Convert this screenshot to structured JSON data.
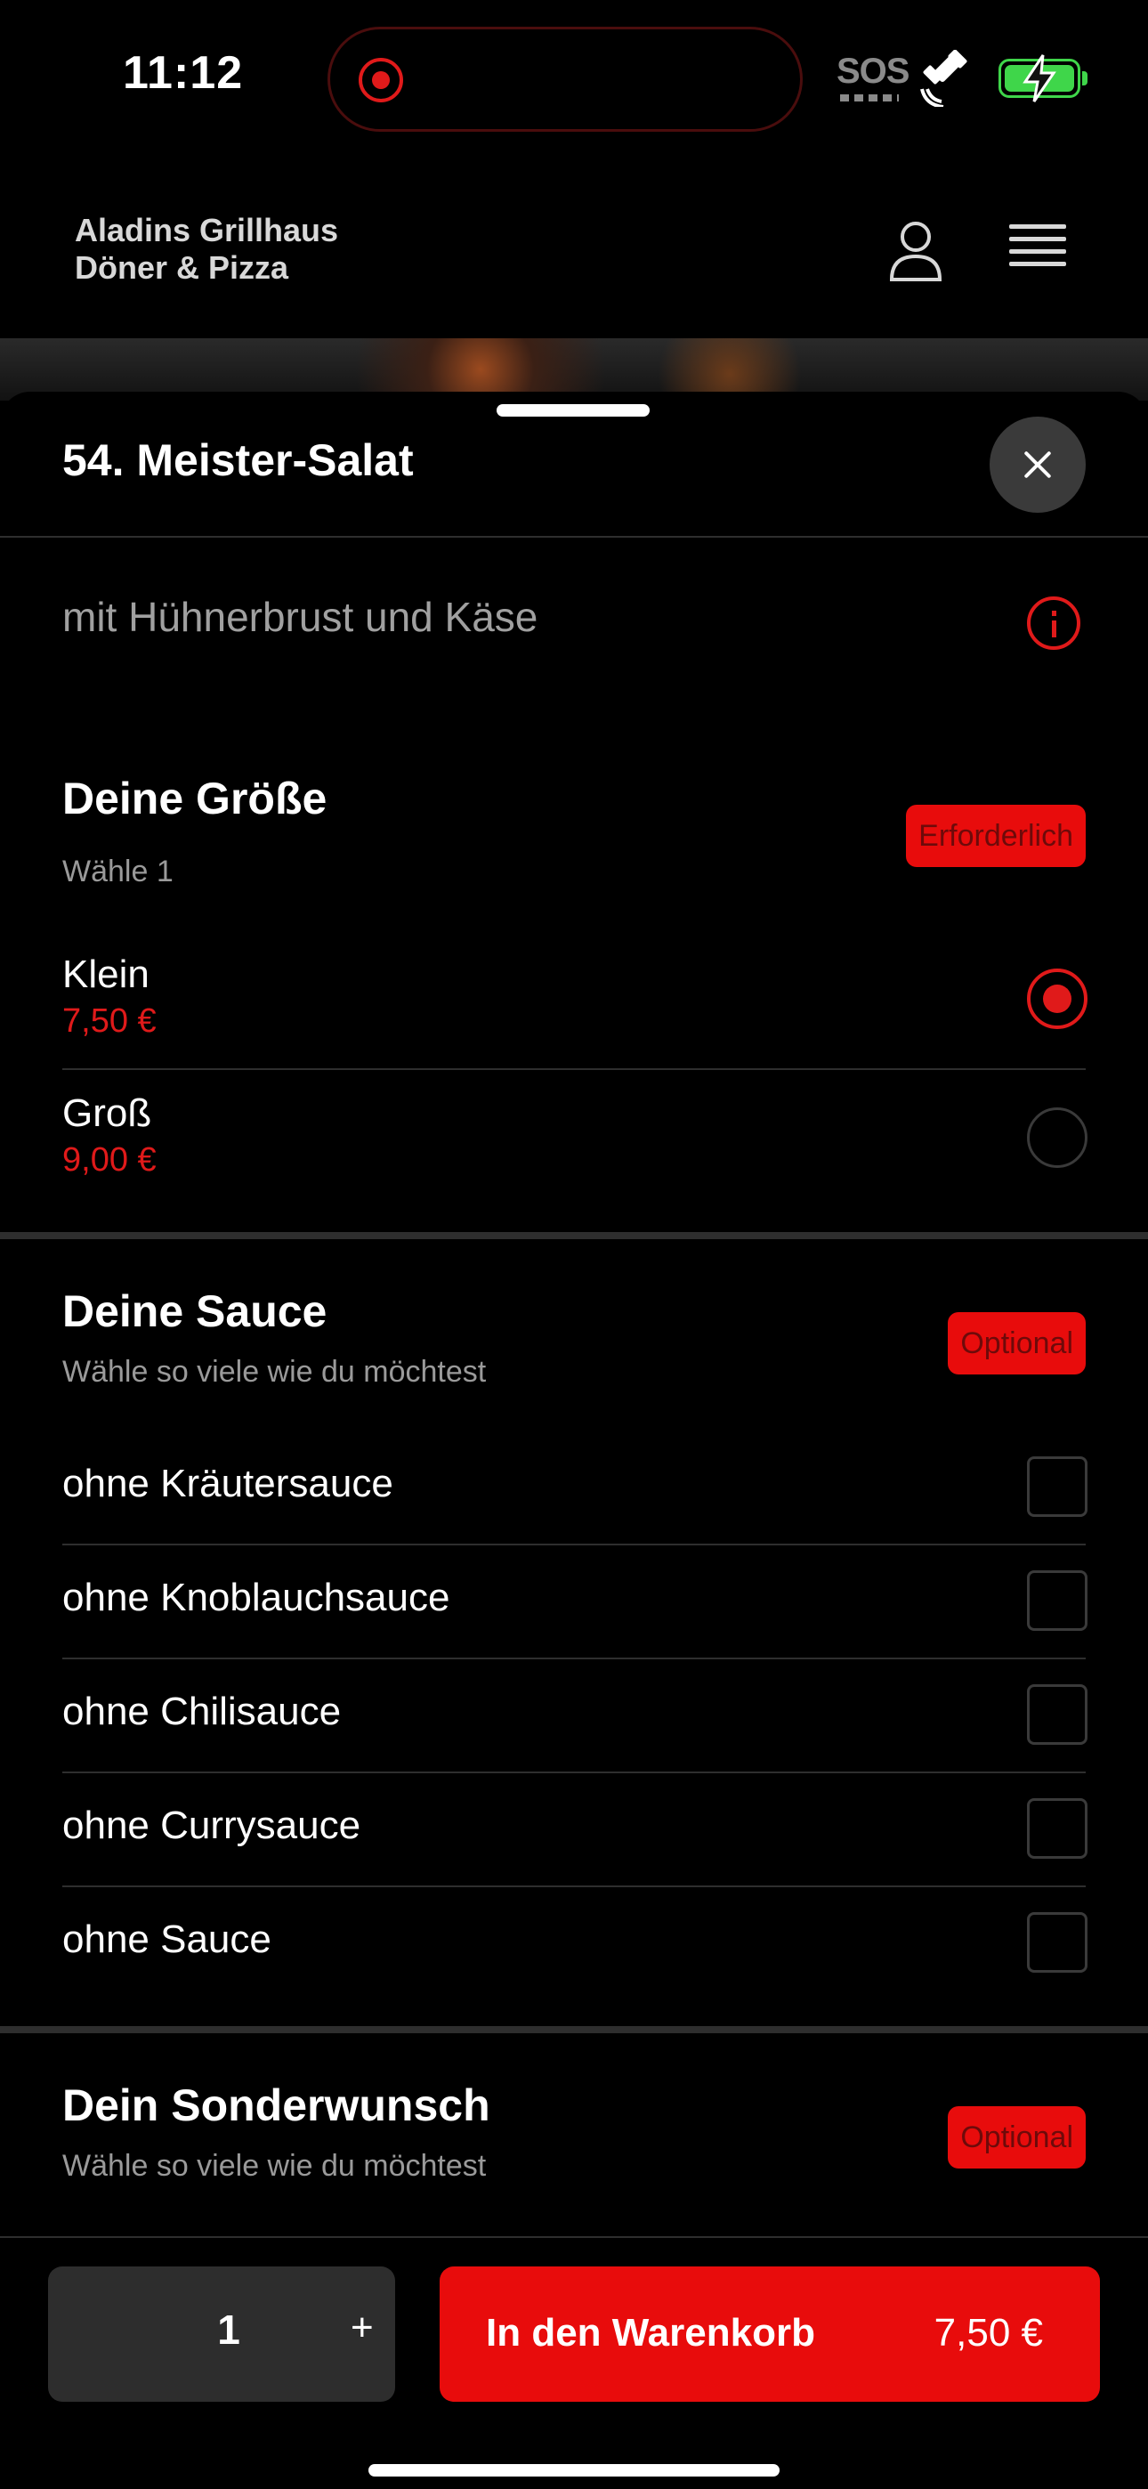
{
  "status_bar": {
    "time": "11:12",
    "sos": "SOS",
    "icons": [
      "record-indicator",
      "satellite-icon",
      "battery-charging-icon"
    ],
    "battery_color": "#3fd64a"
  },
  "header": {
    "brand_line1": "Aladins Grillhaus",
    "brand_line2": "Döner & Pizza",
    "icons": [
      "user-icon",
      "menu-icon"
    ]
  },
  "sheet": {
    "title": "54. Meister-Salat",
    "description": "mit Hühnerbrust und Käse",
    "accent": "#e80c0c"
  },
  "size_section": {
    "title": "Deine Größe",
    "subtitle": "Wähle 1",
    "badge": "Erforderlich",
    "options": [
      {
        "name": "Klein",
        "price": "7,50 €",
        "selected": true
      },
      {
        "name": "Groß",
        "price": "9,00 €",
        "selected": false
      }
    ]
  },
  "sauce_section": {
    "title": "Deine Sauce",
    "subtitle": "Wähle so viele wie du möchtest",
    "badge": "Optional",
    "options": [
      {
        "name": "ohne Kräutersauce",
        "checked": false
      },
      {
        "name": "ohne Knoblauchsauce",
        "checked": false
      },
      {
        "name": "ohne Chilisauce",
        "checked": false
      },
      {
        "name": "ohne Currysauce",
        "checked": false
      },
      {
        "name": "ohne Sauce",
        "checked": false
      }
    ]
  },
  "wish_section": {
    "title": "Dein Sonderwunsch",
    "subtitle": "Wähle so viele wie du möchtest",
    "badge": "Optional"
  },
  "bottom_bar": {
    "quantity": "1",
    "plus": "+",
    "cart_label": "In den Warenkorb",
    "cart_price": "7,50 €"
  }
}
